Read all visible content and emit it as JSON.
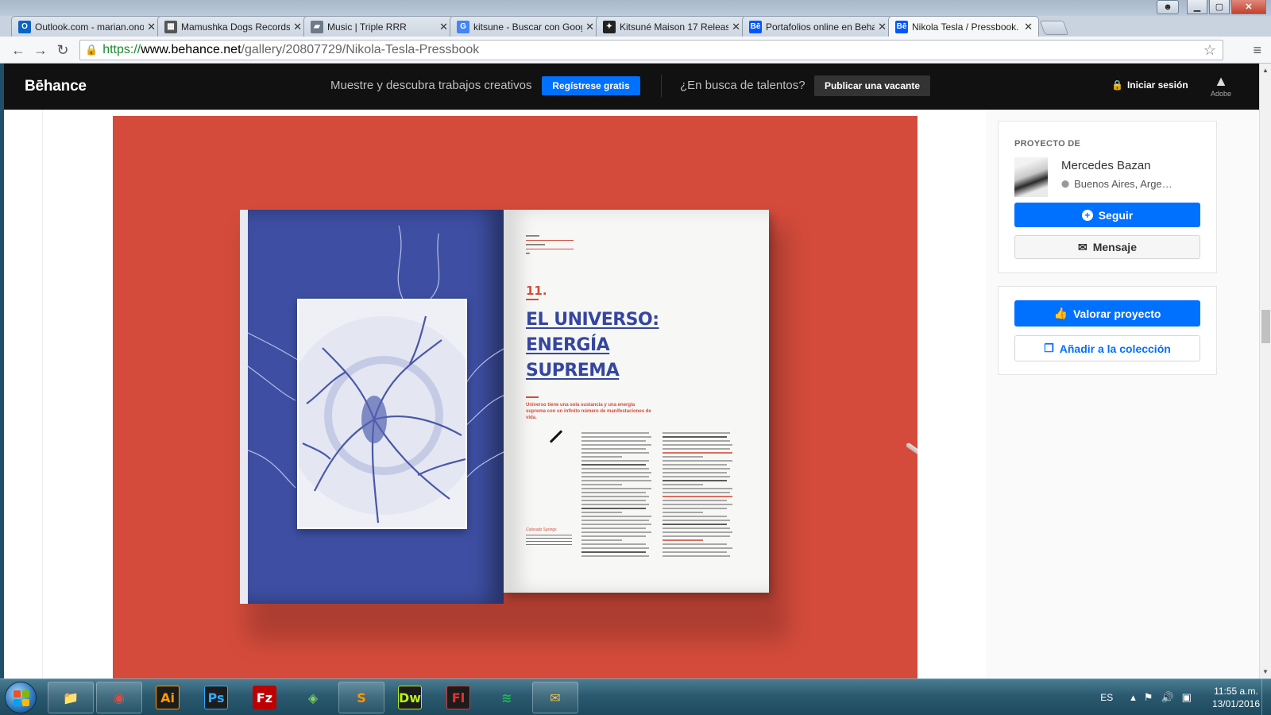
{
  "window": {
    "controls": [
      "user",
      "minimize",
      "maximize",
      "close"
    ]
  },
  "tabs": [
    {
      "title": "Outlook.com - marian.ono",
      "favicon": "O",
      "favicon_color": "#0a64c6",
      "active": false
    },
    {
      "title": "Mamushka Dogs Records",
      "favicon": "▦",
      "favicon_color": "#555555",
      "active": false
    },
    {
      "title": "Music | Triple RRR",
      "favicon": "▰",
      "favicon_color": "#6c7a8a",
      "active": false
    },
    {
      "title": "kitsune - Buscar con Goog",
      "favicon": "G",
      "favicon_color": "#4285f4",
      "active": false
    },
    {
      "title": "Kitsuné Maison 17 Release",
      "favicon": "✦",
      "favicon_color": "#222222",
      "active": false
    },
    {
      "title": "Portafolios online en Beha",
      "favicon": "Bē",
      "favicon_color": "#0057ff",
      "active": false
    },
    {
      "title": "Nikola Tesla / Pressbook.",
      "favicon": "Bē",
      "favicon_color": "#0057ff",
      "active": true
    }
  ],
  "toolbar": {
    "back": "←",
    "forward": "→",
    "reload": "↻",
    "url_scheme": "https://",
    "url_host": "www.behance.net",
    "url_path": "/gallery/20807729/Nikola-Tesla-Pressbook",
    "star": "☆",
    "menu": "≡"
  },
  "behance": {
    "logo": "Bēhance",
    "tagline": "Muestre y descubra trabajos creativos",
    "register": "Regístrese gratis",
    "talent": "¿En busca de talentos?",
    "post_job": "Publicar una vacante",
    "login": "Iniciar sesión",
    "adobe_label": "Adobe"
  },
  "magazine": {
    "chapter": "11.",
    "headline": [
      "EL UNIVERSO:",
      "ENERGÍA",
      "SUPREMA"
    ],
    "lead": "Universo tiene una sola sustancia y una energía suprema con un infinito número de manifestaciones de vida.",
    "side_caption": "Colorado Springs"
  },
  "sidebar": {
    "owner_label": "PROYECTO DE",
    "owner_name": "Mercedes Bazan",
    "owner_location": "Buenos Aires, Arge…",
    "follow": "Seguir",
    "message": "Mensaje",
    "appreciate": "Valorar proyecto",
    "add_collection": "Añadir a la colección"
  },
  "taskbar": {
    "apps": [
      {
        "name": "explorer",
        "label": "📁",
        "color": "#e8b84a"
      },
      {
        "name": "chrome",
        "label": "◉",
        "color": "#e24b3b"
      },
      {
        "name": "illustrator",
        "label": "Ai",
        "color": "#ff9a00"
      },
      {
        "name": "photoshop",
        "label": "Ps",
        "color": "#31a8ff"
      },
      {
        "name": "filezilla",
        "label": "Fz",
        "color": "#ffffff"
      },
      {
        "name": "layers",
        "label": "◈",
        "color": "#7fd35a"
      },
      {
        "name": "sublime",
        "label": "S",
        "color": "#ff9800"
      },
      {
        "name": "dreamweaver",
        "label": "Dw",
        "color": "#b6f01e"
      },
      {
        "name": "flash",
        "label": "Fl",
        "color": "#e8322f"
      },
      {
        "name": "spotify",
        "label": "≋",
        "color": "#1db954"
      },
      {
        "name": "mail",
        "label": "✉",
        "color": "#f0c24a"
      }
    ],
    "language": "ES",
    "time": "11:55 a.m.",
    "date": "13/01/2016"
  }
}
